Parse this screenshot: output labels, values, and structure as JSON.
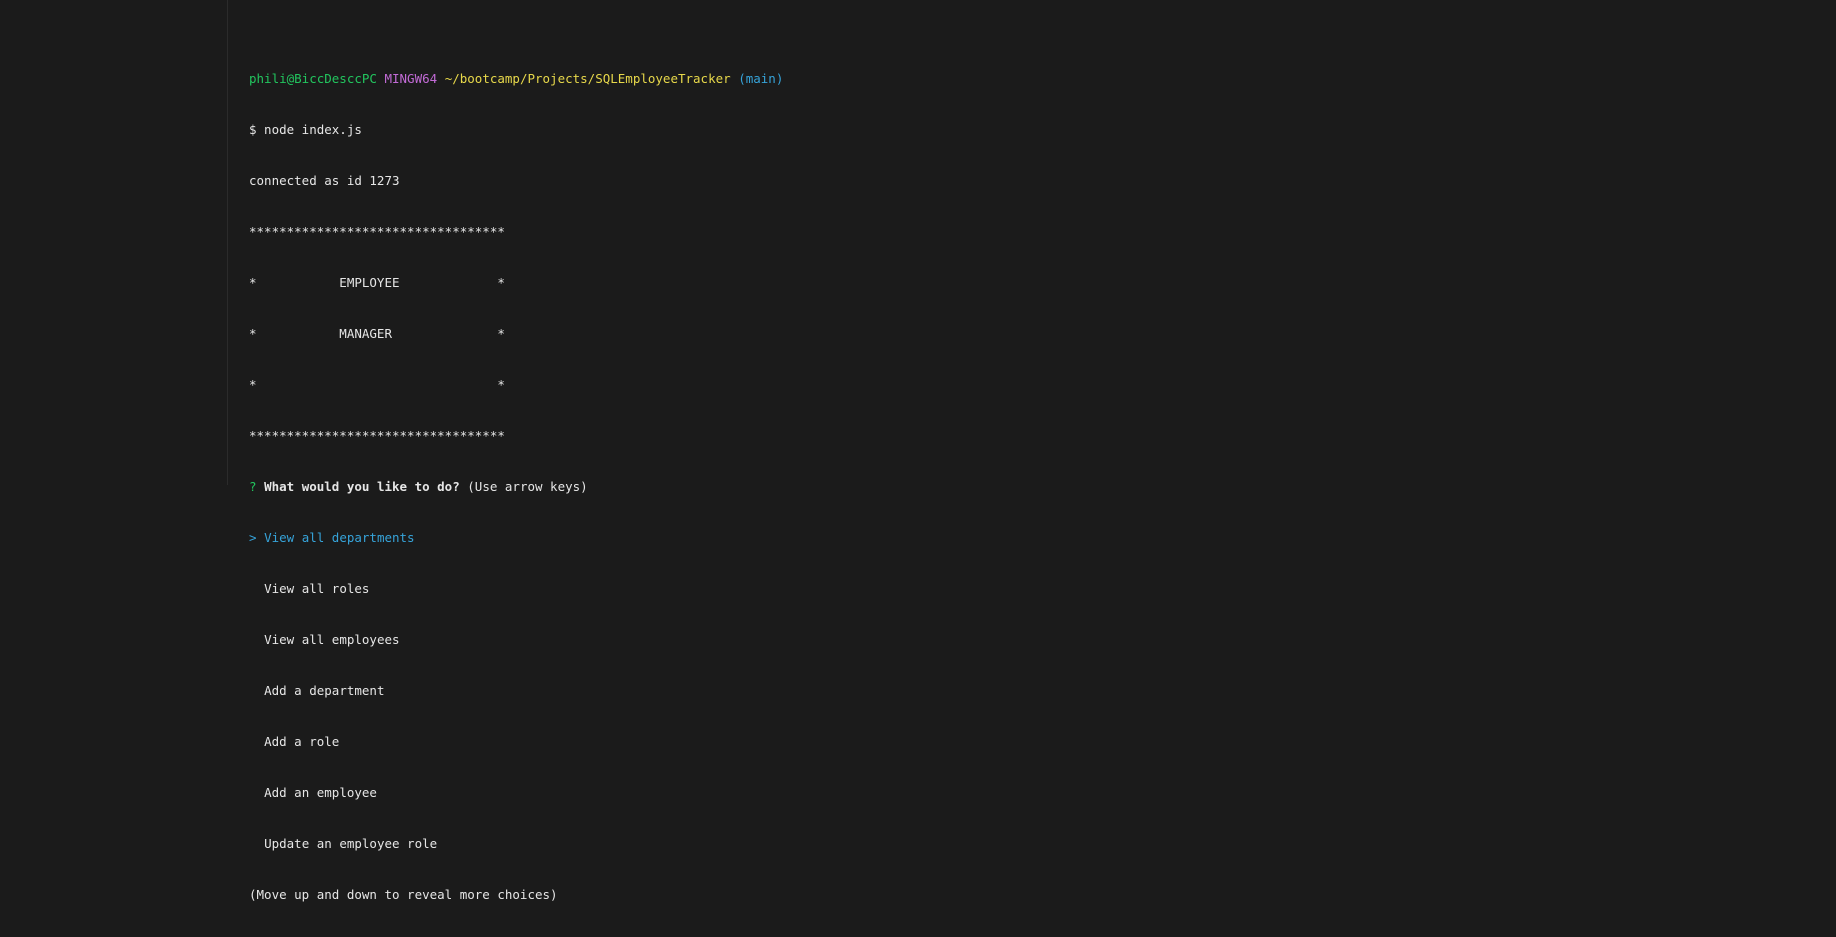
{
  "prompt": {
    "user_host": "phili@BiccDesccPC",
    "env": "MINGW64",
    "path": "~/bootcamp/Projects/SQLEmployeeTracker",
    "branch": "(main)"
  },
  "command": "$ node index.js",
  "connected": "connected as id 1273",
  "banner": [
    "**********************************",
    "*           EMPLOYEE             *",
    "*           MANAGER              *",
    "*                                *",
    "**********************************"
  ],
  "question": {
    "mark": "?",
    "text": "What would you like to do?",
    "hint": "(Use arrow keys)"
  },
  "menu": {
    "pointer": ">",
    "selected": "View all departments",
    "items": [
      "View all roles",
      "View all employees",
      "Add a department",
      "Add a role",
      "Add an employee",
      "Update an employee role"
    ]
  },
  "footer_hint": "(Move up and down to reveal more choices)",
  "colors": {
    "background": "#1b1b1b",
    "text": "#e6e6e6",
    "user_host": "#22c55e",
    "env": "#c26bd6",
    "path": "#e7d84a",
    "branch": "#36a3d9",
    "selected": "#36a3d9"
  }
}
